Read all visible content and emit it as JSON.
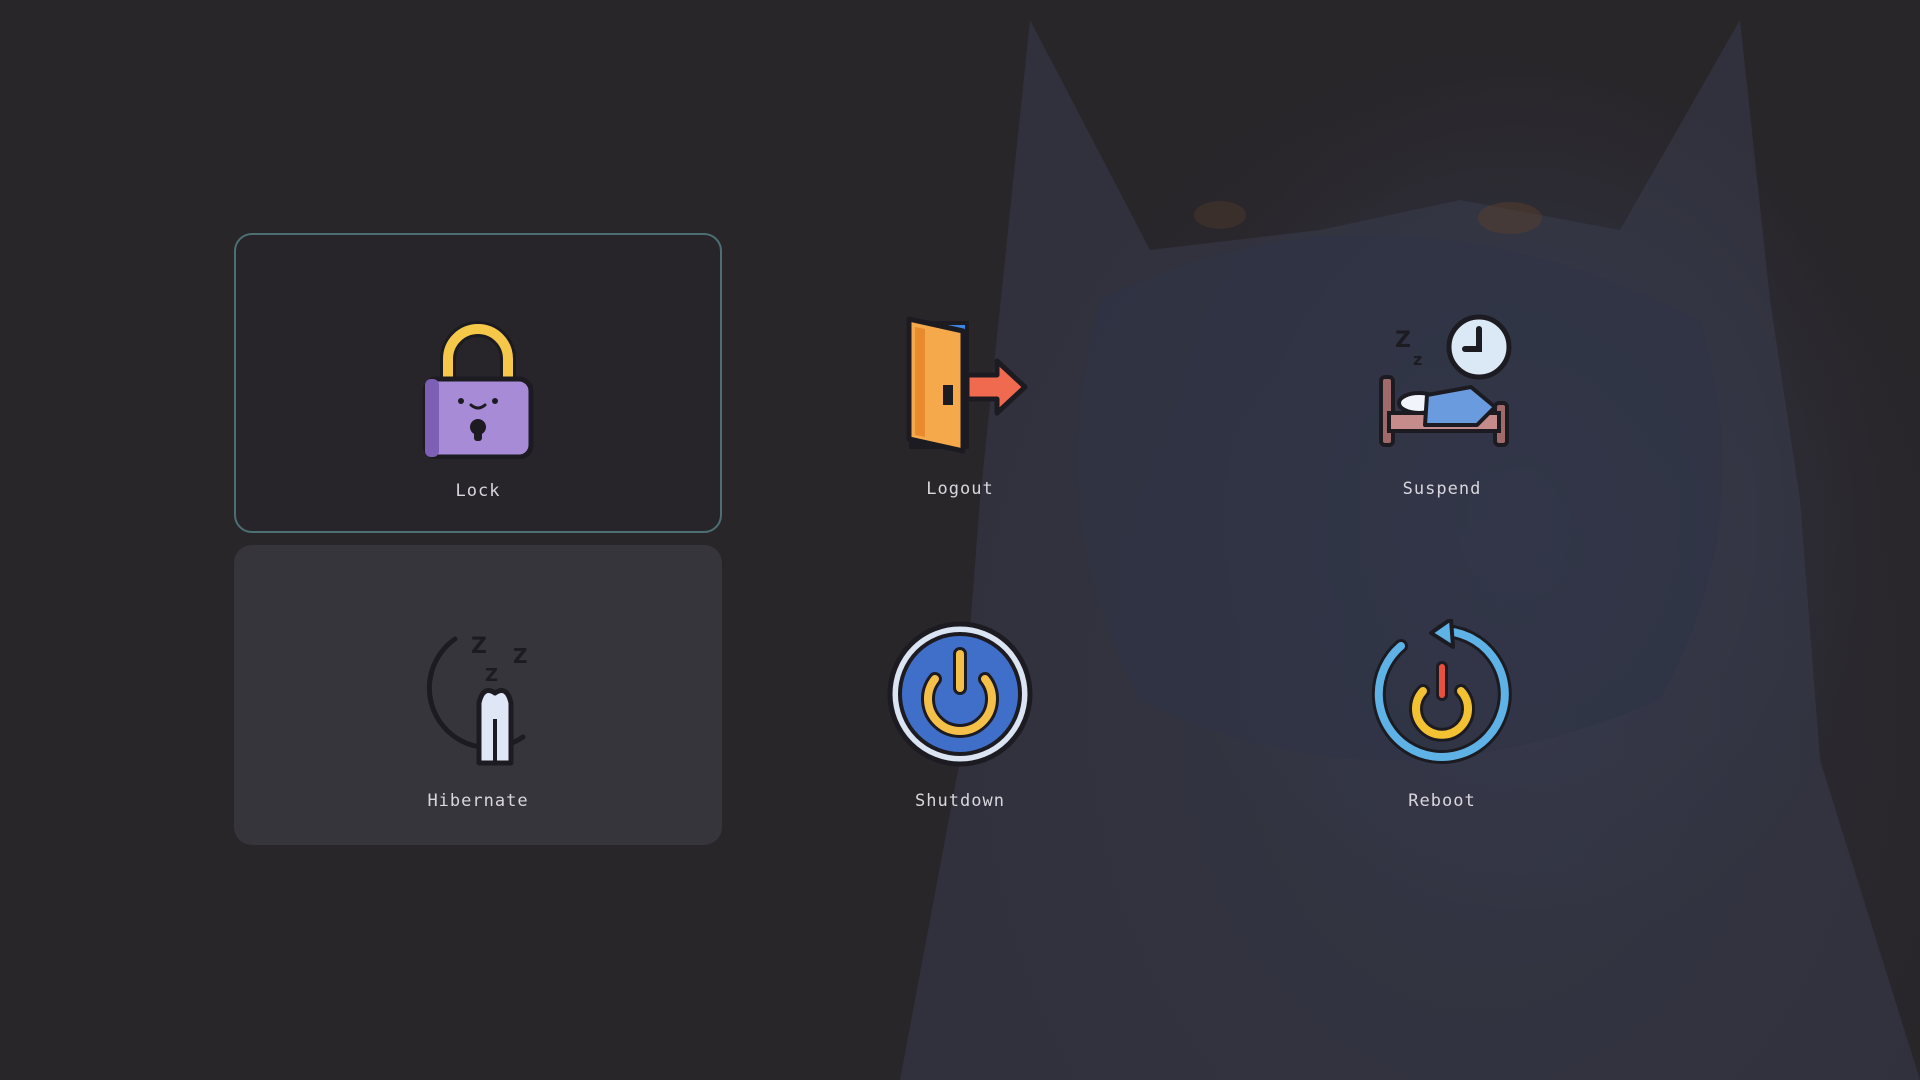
{
  "actions": [
    {
      "id": "lock",
      "label": "Lock",
      "icon": "padlock-icon",
      "state": "selected"
    },
    {
      "id": "logout",
      "label": "Logout",
      "icon": "door-exit-icon",
      "state": "normal"
    },
    {
      "id": "suspend",
      "label": "Suspend",
      "icon": "sleep-bed-clock-icon",
      "state": "normal"
    },
    {
      "id": "hibernate",
      "label": "Hibernate",
      "icon": "moon-sleep-icon",
      "state": "hover"
    },
    {
      "id": "shutdown",
      "label": "Shutdown",
      "icon": "power-button-icon",
      "state": "normal"
    },
    {
      "id": "reboot",
      "label": "Reboot",
      "icon": "restart-power-icon",
      "state": "normal"
    }
  ],
  "colors": {
    "background": "#29262a",
    "selected_border": "#4c6f74",
    "hover_background": "#37353c",
    "label_text": "#d9d6dd"
  }
}
